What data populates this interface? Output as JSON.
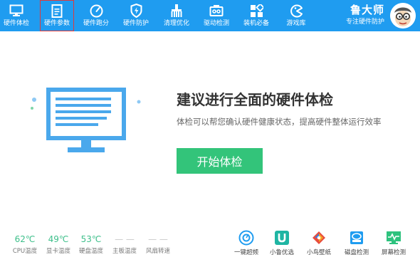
{
  "nav": {
    "items": [
      {
        "label": "硬件体检",
        "icon": "monitor-icon"
      },
      {
        "label": "硬件参数",
        "icon": "document-icon"
      },
      {
        "label": "硬件跑分",
        "icon": "gauge-icon"
      },
      {
        "label": "硬件防护",
        "icon": "shield-bolt-icon"
      },
      {
        "label": "清理优化",
        "icon": "brush-icon"
      },
      {
        "label": "驱动检测",
        "icon": "driver-chip-icon"
      },
      {
        "label": "装机必备",
        "icon": "apps-grid-icon"
      },
      {
        "label": "游戏库",
        "icon": "pacman-icon"
      }
    ],
    "active_index": 1
  },
  "brand": {
    "name": "鲁大师",
    "slogan": "专注硬件防护"
  },
  "main": {
    "headline": "建议进行全面的硬件体检",
    "subline": "体检可以帮您确认硬件健康状态，提高硬件整体运行效率",
    "start_button": "开始体检"
  },
  "stats": [
    {
      "value": "62℃",
      "label": "CPU温度"
    },
    {
      "value": "49℃",
      "label": "显卡温度"
    },
    {
      "value": "53℃",
      "label": "硬盘温度"
    },
    {
      "value": "— —",
      "label": "主板温度"
    },
    {
      "value": "— —",
      "label": "风扇转速"
    }
  ],
  "tools": [
    {
      "label": "一键超频",
      "icon": "overclock-icon"
    },
    {
      "label": "小鲁优选",
      "icon": "u-shop-icon"
    },
    {
      "label": "小鸟壁纸",
      "icon": "bird-wallpaper-icon"
    },
    {
      "label": "磁盘检测",
      "icon": "disk-check-icon"
    },
    {
      "label": "屏幕检测",
      "icon": "screen-check-icon"
    }
  ],
  "colors": {
    "topbar": "#1f9cf0",
    "accent_green": "#33c47a",
    "temp_green": "#3dbf8a",
    "monitor_blue": "#4aa8ec",
    "active_border": "#e03a3a"
  }
}
